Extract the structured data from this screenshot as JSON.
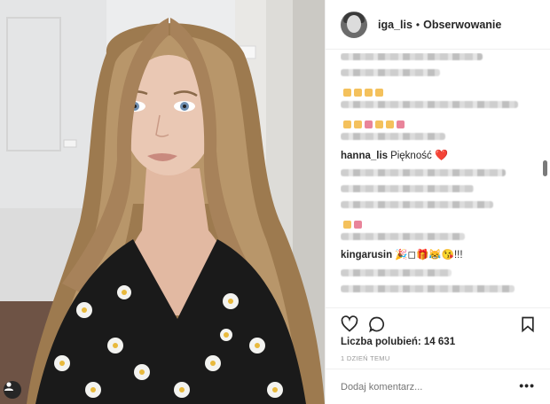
{
  "post": {
    "username": "iga_lis",
    "separator": "•",
    "follow_label": "Obserwowanie",
    "comments": [
      {
        "user": "hanna_lis",
        "text": "Piękność",
        "emoji": "❤️"
      },
      {
        "user": "kingarusin",
        "text": "🎉◻🎁😹😘!!!"
      }
    ],
    "likes_label": "Liczba polubień: 14 631",
    "time_label": "1 DZIEŃ TEMU",
    "comment_placeholder": "Dodaj komentarz...",
    "more_options": "•••"
  },
  "icons": {
    "like": "heart-outline-icon",
    "comment": "speech-bubble-icon",
    "save": "bookmark-icon",
    "photo_badge": "user-tag-icon"
  },
  "colors": {
    "text": "#262626",
    "muted": "#999999",
    "border": "#efefef",
    "heart": "#e8223a"
  }
}
